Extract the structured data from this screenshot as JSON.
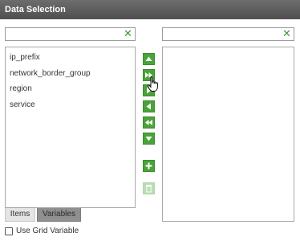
{
  "header": {
    "title": "Data Selection"
  },
  "left": {
    "filter": {
      "value": "",
      "placeholder": ""
    },
    "items": [
      {
        "label": "ip_prefix"
      },
      {
        "label": "network_border_group"
      },
      {
        "label": "region"
      },
      {
        "label": "service"
      }
    ],
    "tabs": {
      "items_label": "Items",
      "variables_label": "Variables"
    }
  },
  "right": {
    "filter": {
      "value": "",
      "placeholder": ""
    },
    "items": []
  },
  "options": {
    "use_grid_variable_label": "Use Grid Variable",
    "use_grid_variable_checked": false
  },
  "colors": {
    "accent": "#4aa33a",
    "accent_disabled": "#b9ddb2",
    "header": "#5a5a5a"
  },
  "icons": {
    "move_up": "triangle-up-icon",
    "add_all": "double-chevron-right-icon",
    "add_selected": "triangle-right-icon",
    "remove_selected": "triangle-left-icon",
    "remove_all": "double-chevron-left-icon",
    "move_down": "triangle-down-icon",
    "add": "plus-icon",
    "delete": "trash-icon"
  }
}
